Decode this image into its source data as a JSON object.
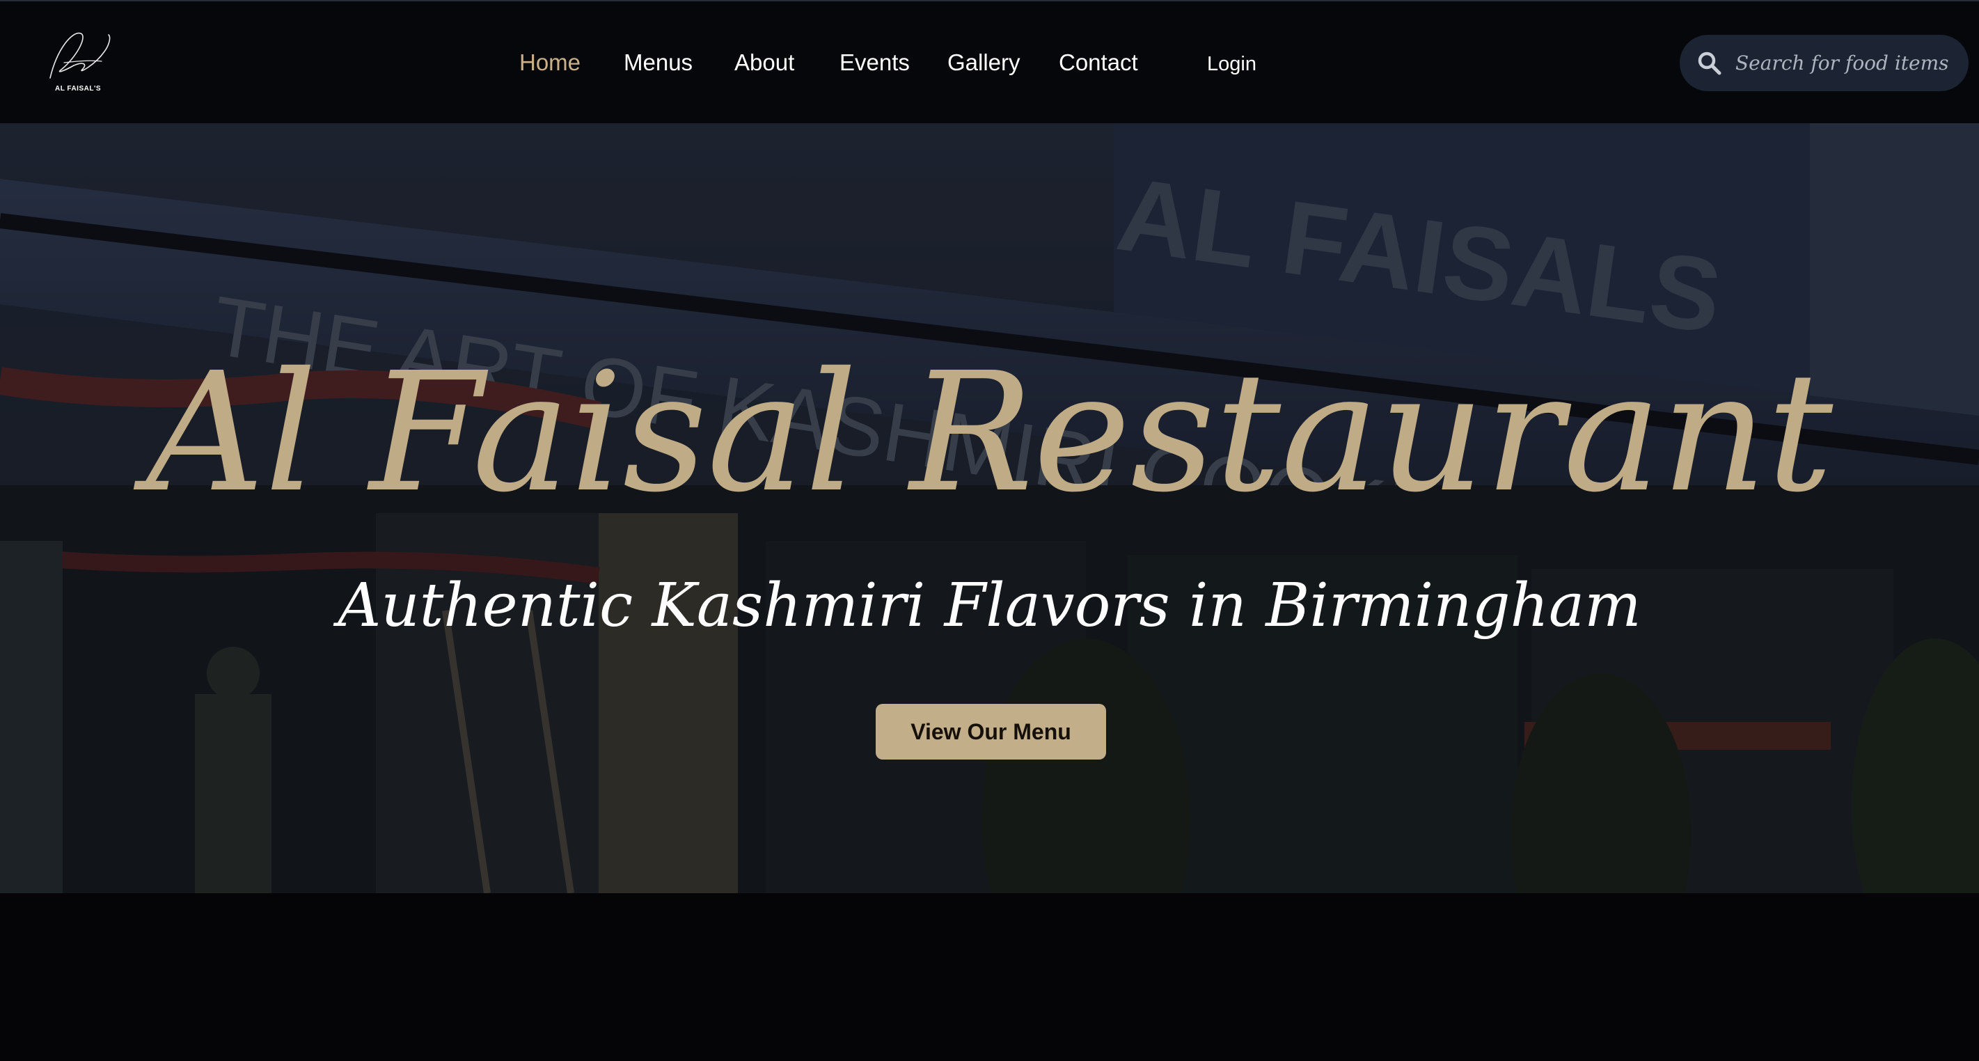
{
  "logo": {
    "text": "AL FAISAL'S"
  },
  "nav": {
    "items": [
      {
        "label": "Home",
        "active": true
      },
      {
        "label": "Menus"
      },
      {
        "label": "About"
      },
      {
        "label": "Events"
      },
      {
        "label": "Gallery"
      },
      {
        "label": "Contact"
      }
    ],
    "login_label": "Login"
  },
  "search": {
    "placeholder": "Search for food items",
    "icon": "search-icon"
  },
  "hero": {
    "title": "Al Faisal Restaurant",
    "subtitle": "Authentic Kashmiri Flavors in Birmingham",
    "button_label": "View Our Menu"
  },
  "colors": {
    "accent": "#c2ae89",
    "active_nav": "#c9b08a",
    "header_bg": "#06070a",
    "search_bg": "#1c2433"
  }
}
